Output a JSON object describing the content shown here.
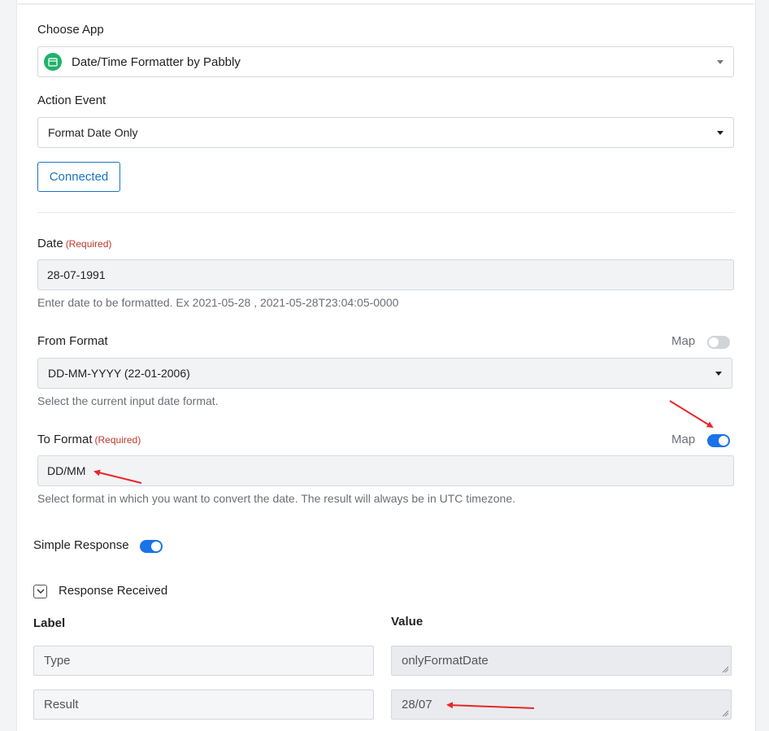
{
  "choose_app": {
    "label": "Choose App",
    "selected": "Date/Time Formatter by Pabbly",
    "icon": "calendar-icon"
  },
  "action_event": {
    "label": "Action Event",
    "selected": "Format Date Only"
  },
  "connected_label": "Connected",
  "date": {
    "label": "Date",
    "required": "(Required)",
    "value": "28-07-1991",
    "help": "Enter date to be formatted. Ex 2021-05-28 , 2021-05-28T23:04:05-0000"
  },
  "from_format": {
    "label": "From Format",
    "map_label": "Map",
    "map_on": false,
    "selected": "DD-MM-YYYY (22-01-2006)",
    "help": "Select the current input date format."
  },
  "to_format": {
    "label": "To Format",
    "required": "(Required)",
    "map_label": "Map",
    "map_on": true,
    "value": "DD/MM",
    "help": "Select format in which you want to convert the date. The result will always be in UTC timezone."
  },
  "simple_response": {
    "label": "Simple Response",
    "on": true
  },
  "response": {
    "label": "Response Received",
    "col_label": "Label",
    "col_value": "Value",
    "rows": [
      {
        "label": "Type",
        "value": "onlyFormatDate"
      },
      {
        "label": "Result",
        "value": "28/07"
      }
    ]
  },
  "colors": {
    "accent": "#1a73e8",
    "required": "#c0392b",
    "app_icon": "#20b26b",
    "arrow": "#e8262a"
  }
}
